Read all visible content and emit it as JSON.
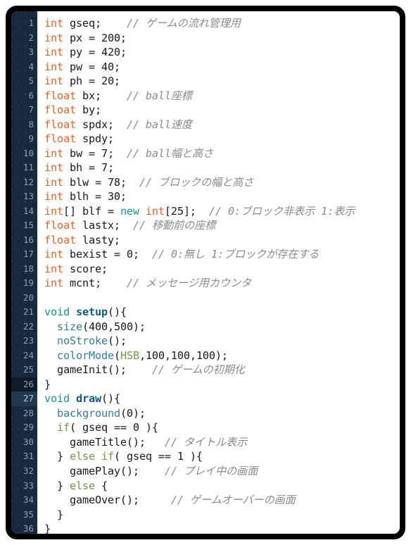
{
  "window": {
    "frame_color": "#000000",
    "gutter_color": "#16293d",
    "code_background": "#ffffff",
    "line_number_color": "#8d9ead",
    "highlighted_line": 27,
    "dimmed_line": 26,
    "total_lines": 36
  },
  "theme": {
    "type_keyword_color": "#f2601f",
    "keyword_color": "#0f9b8e",
    "control_color": "#6d9c3c",
    "builtin_function_color": "#2e7fa8",
    "function_definition_color": "#0b5a96",
    "comment_color": "#8c8c8c",
    "plain_text_color": "#1a1a1a"
  },
  "editor": {
    "language": "Processing",
    "lines": [
      {
        "n": "1",
        "tokens": [
          {
            "t": "int",
            "c": "t-type"
          },
          {
            "t": " gseq;    ",
            "c": "t-plain"
          },
          {
            "t": "// ゲームの流れ管理用",
            "c": "t-comment"
          }
        ]
      },
      {
        "n": "2",
        "tokens": [
          {
            "t": "int",
            "c": "t-type"
          },
          {
            "t": " px = 200;",
            "c": "t-plain"
          }
        ]
      },
      {
        "n": "3",
        "tokens": [
          {
            "t": "int",
            "c": "t-type"
          },
          {
            "t": " py = 420;",
            "c": "t-plain"
          }
        ]
      },
      {
        "n": "4",
        "tokens": [
          {
            "t": "int",
            "c": "t-type"
          },
          {
            "t": " pw = 40;",
            "c": "t-plain"
          }
        ]
      },
      {
        "n": "5",
        "tokens": [
          {
            "t": "int",
            "c": "t-type"
          },
          {
            "t": " ph = 20;",
            "c": "t-plain"
          }
        ]
      },
      {
        "n": "6",
        "tokens": [
          {
            "t": "float",
            "c": "t-type"
          },
          {
            "t": " bx;    ",
            "c": "t-plain"
          },
          {
            "t": "// ball座標",
            "c": "t-comment"
          }
        ]
      },
      {
        "n": "7",
        "tokens": [
          {
            "t": "float",
            "c": "t-type"
          },
          {
            "t": " by;",
            "c": "t-plain"
          }
        ]
      },
      {
        "n": "8",
        "tokens": [
          {
            "t": "float",
            "c": "t-type"
          },
          {
            "t": " spdx;  ",
            "c": "t-plain"
          },
          {
            "t": "// ball速度",
            "c": "t-comment"
          }
        ]
      },
      {
        "n": "9",
        "tokens": [
          {
            "t": "float",
            "c": "t-type"
          },
          {
            "t": " spdy;",
            "c": "t-plain"
          }
        ]
      },
      {
        "n": "10",
        "tokens": [
          {
            "t": "int",
            "c": "t-type"
          },
          {
            "t": " bw = 7;  ",
            "c": "t-plain"
          },
          {
            "t": "// ball幅と高さ",
            "c": "t-comment"
          }
        ]
      },
      {
        "n": "11",
        "tokens": [
          {
            "t": "int",
            "c": "t-type"
          },
          {
            "t": " bh = 7;",
            "c": "t-plain"
          }
        ]
      },
      {
        "n": "12",
        "tokens": [
          {
            "t": "int",
            "c": "t-type"
          },
          {
            "t": " blw = 78;  ",
            "c": "t-plain"
          },
          {
            "t": "// ブロックの幅と高さ",
            "c": "t-comment"
          }
        ]
      },
      {
        "n": "13",
        "tokens": [
          {
            "t": "int",
            "c": "t-type"
          },
          {
            "t": " blh = 30;",
            "c": "t-plain"
          }
        ]
      },
      {
        "n": "14",
        "tokens": [
          {
            "t": "int",
            "c": "t-type"
          },
          {
            "t": "[] blf = ",
            "c": "t-plain"
          },
          {
            "t": "new",
            "c": "t-kw"
          },
          {
            "t": " ",
            "c": "t-plain"
          },
          {
            "t": "int",
            "c": "t-type"
          },
          {
            "t": "[25];  ",
            "c": "t-plain"
          },
          {
            "t": "// 0:ブロック非表示 1:表示",
            "c": "t-comment"
          }
        ]
      },
      {
        "n": "15",
        "tokens": [
          {
            "t": "float",
            "c": "t-type"
          },
          {
            "t": " lastx;  ",
            "c": "t-plain"
          },
          {
            "t": "// 移動前の座標",
            "c": "t-comment"
          }
        ]
      },
      {
        "n": "16",
        "tokens": [
          {
            "t": "float",
            "c": "t-type"
          },
          {
            "t": " lasty;",
            "c": "t-plain"
          }
        ]
      },
      {
        "n": "17",
        "tokens": [
          {
            "t": "int",
            "c": "t-type"
          },
          {
            "t": " bexist = 0;  ",
            "c": "t-plain"
          },
          {
            "t": "// 0:無し 1:ブロックが存在する",
            "c": "t-comment"
          }
        ]
      },
      {
        "n": "18",
        "tokens": [
          {
            "t": "int",
            "c": "t-type"
          },
          {
            "t": " score;",
            "c": "t-plain"
          }
        ]
      },
      {
        "n": "19",
        "tokens": [
          {
            "t": "int",
            "c": "t-type"
          },
          {
            "t": " mcnt;    ",
            "c": "t-plain"
          },
          {
            "t": "// メッセージ用カウンタ",
            "c": "t-comment"
          }
        ]
      },
      {
        "n": "20",
        "tokens": []
      },
      {
        "n": "21",
        "tokens": [
          {
            "t": "void",
            "c": "t-kw"
          },
          {
            "t": " ",
            "c": "t-plain"
          },
          {
            "t": "setup",
            "c": "t-fndef"
          },
          {
            "t": "(){",
            "c": "t-plain"
          }
        ]
      },
      {
        "n": "22",
        "tokens": [
          {
            "t": "  ",
            "c": "t-plain"
          },
          {
            "t": "size",
            "c": "t-builtin"
          },
          {
            "t": "(400,500);",
            "c": "t-plain"
          }
        ]
      },
      {
        "n": "23",
        "tokens": [
          {
            "t": "  ",
            "c": "t-plain"
          },
          {
            "t": "noStroke",
            "c": "t-builtin"
          },
          {
            "t": "();",
            "c": "t-plain"
          }
        ]
      },
      {
        "n": "24",
        "tokens": [
          {
            "t": "  ",
            "c": "t-plain"
          },
          {
            "t": "colorMode",
            "c": "t-builtin"
          },
          {
            "t": "(",
            "c": "t-plain"
          },
          {
            "t": "HSB",
            "c": "t-const"
          },
          {
            "t": ",100,100,100);",
            "c": "t-plain"
          }
        ]
      },
      {
        "n": "25",
        "tokens": [
          {
            "t": "  gameInit();    ",
            "c": "t-plain"
          },
          {
            "t": "// ゲームの初期化",
            "c": "t-comment"
          }
        ]
      },
      {
        "n": "26",
        "tokens": [
          {
            "t": "}",
            "c": "t-plain"
          }
        ]
      },
      {
        "n": "27",
        "tokens": [
          {
            "t": "void",
            "c": "t-kw"
          },
          {
            "t": " ",
            "c": "t-plain"
          },
          {
            "t": "draw",
            "c": "t-fndef"
          },
          {
            "t": "(){",
            "c": "t-plain"
          }
        ]
      },
      {
        "n": "28",
        "tokens": [
          {
            "t": "  ",
            "c": "t-plain"
          },
          {
            "t": "background",
            "c": "t-builtin"
          },
          {
            "t": "(0);",
            "c": "t-plain"
          }
        ]
      },
      {
        "n": "29",
        "tokens": [
          {
            "t": "  ",
            "c": "t-plain"
          },
          {
            "t": "if",
            "c": "t-ctrl"
          },
          {
            "t": "( gseq == 0 ){",
            "c": "t-plain"
          }
        ]
      },
      {
        "n": "30",
        "tokens": [
          {
            "t": "    gameTitle();   ",
            "c": "t-plain"
          },
          {
            "t": "// タイトル表示",
            "c": "t-comment"
          }
        ]
      },
      {
        "n": "31",
        "tokens": [
          {
            "t": "  } ",
            "c": "t-plain"
          },
          {
            "t": "else",
            "c": "t-ctrl"
          },
          {
            "t": " ",
            "c": "t-plain"
          },
          {
            "t": "if",
            "c": "t-ctrl"
          },
          {
            "t": "( gseq == 1 ){",
            "c": "t-plain"
          }
        ]
      },
      {
        "n": "32",
        "tokens": [
          {
            "t": "    gamePlay();    ",
            "c": "t-plain"
          },
          {
            "t": "// プレイ中の画面",
            "c": "t-comment"
          }
        ]
      },
      {
        "n": "33",
        "tokens": [
          {
            "t": "  } ",
            "c": "t-plain"
          },
          {
            "t": "else",
            "c": "t-ctrl"
          },
          {
            "t": " {",
            "c": "t-plain"
          }
        ]
      },
      {
        "n": "34",
        "tokens": [
          {
            "t": "    gameOver();     ",
            "c": "t-plain"
          },
          {
            "t": "// ゲームオーバーの画面",
            "c": "t-comment"
          }
        ]
      },
      {
        "n": "35",
        "tokens": [
          {
            "t": "  }",
            "c": "t-plain"
          }
        ]
      },
      {
        "n": "36",
        "tokens": [
          {
            "t": "}",
            "c": "t-plain"
          }
        ]
      }
    ]
  }
}
